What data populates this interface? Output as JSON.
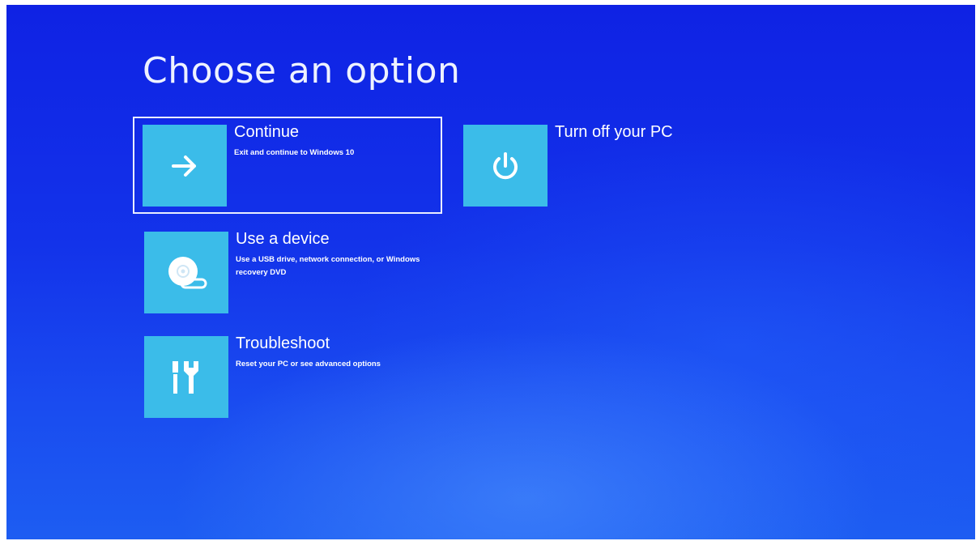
{
  "title": "Choose an option",
  "options": [
    {
      "label": "Continue",
      "description": "Exit and continue to Windows 10",
      "icon": "arrow-right-icon",
      "selected": true
    },
    {
      "label": "Turn off your PC",
      "description": "",
      "icon": "power-icon",
      "selected": false
    },
    {
      "label": "Use a device",
      "description": "Use a USB drive, network connection, or Windows recovery DVD",
      "icon": "disc-device-icon",
      "selected": false
    },
    {
      "label": "Troubleshoot",
      "description": "Reset your PC or see advanced options",
      "icon": "tools-icon",
      "selected": false
    }
  ],
  "colors": {
    "background": "#1333ea",
    "tile": "#3bbce9",
    "text": "#ffffff"
  }
}
